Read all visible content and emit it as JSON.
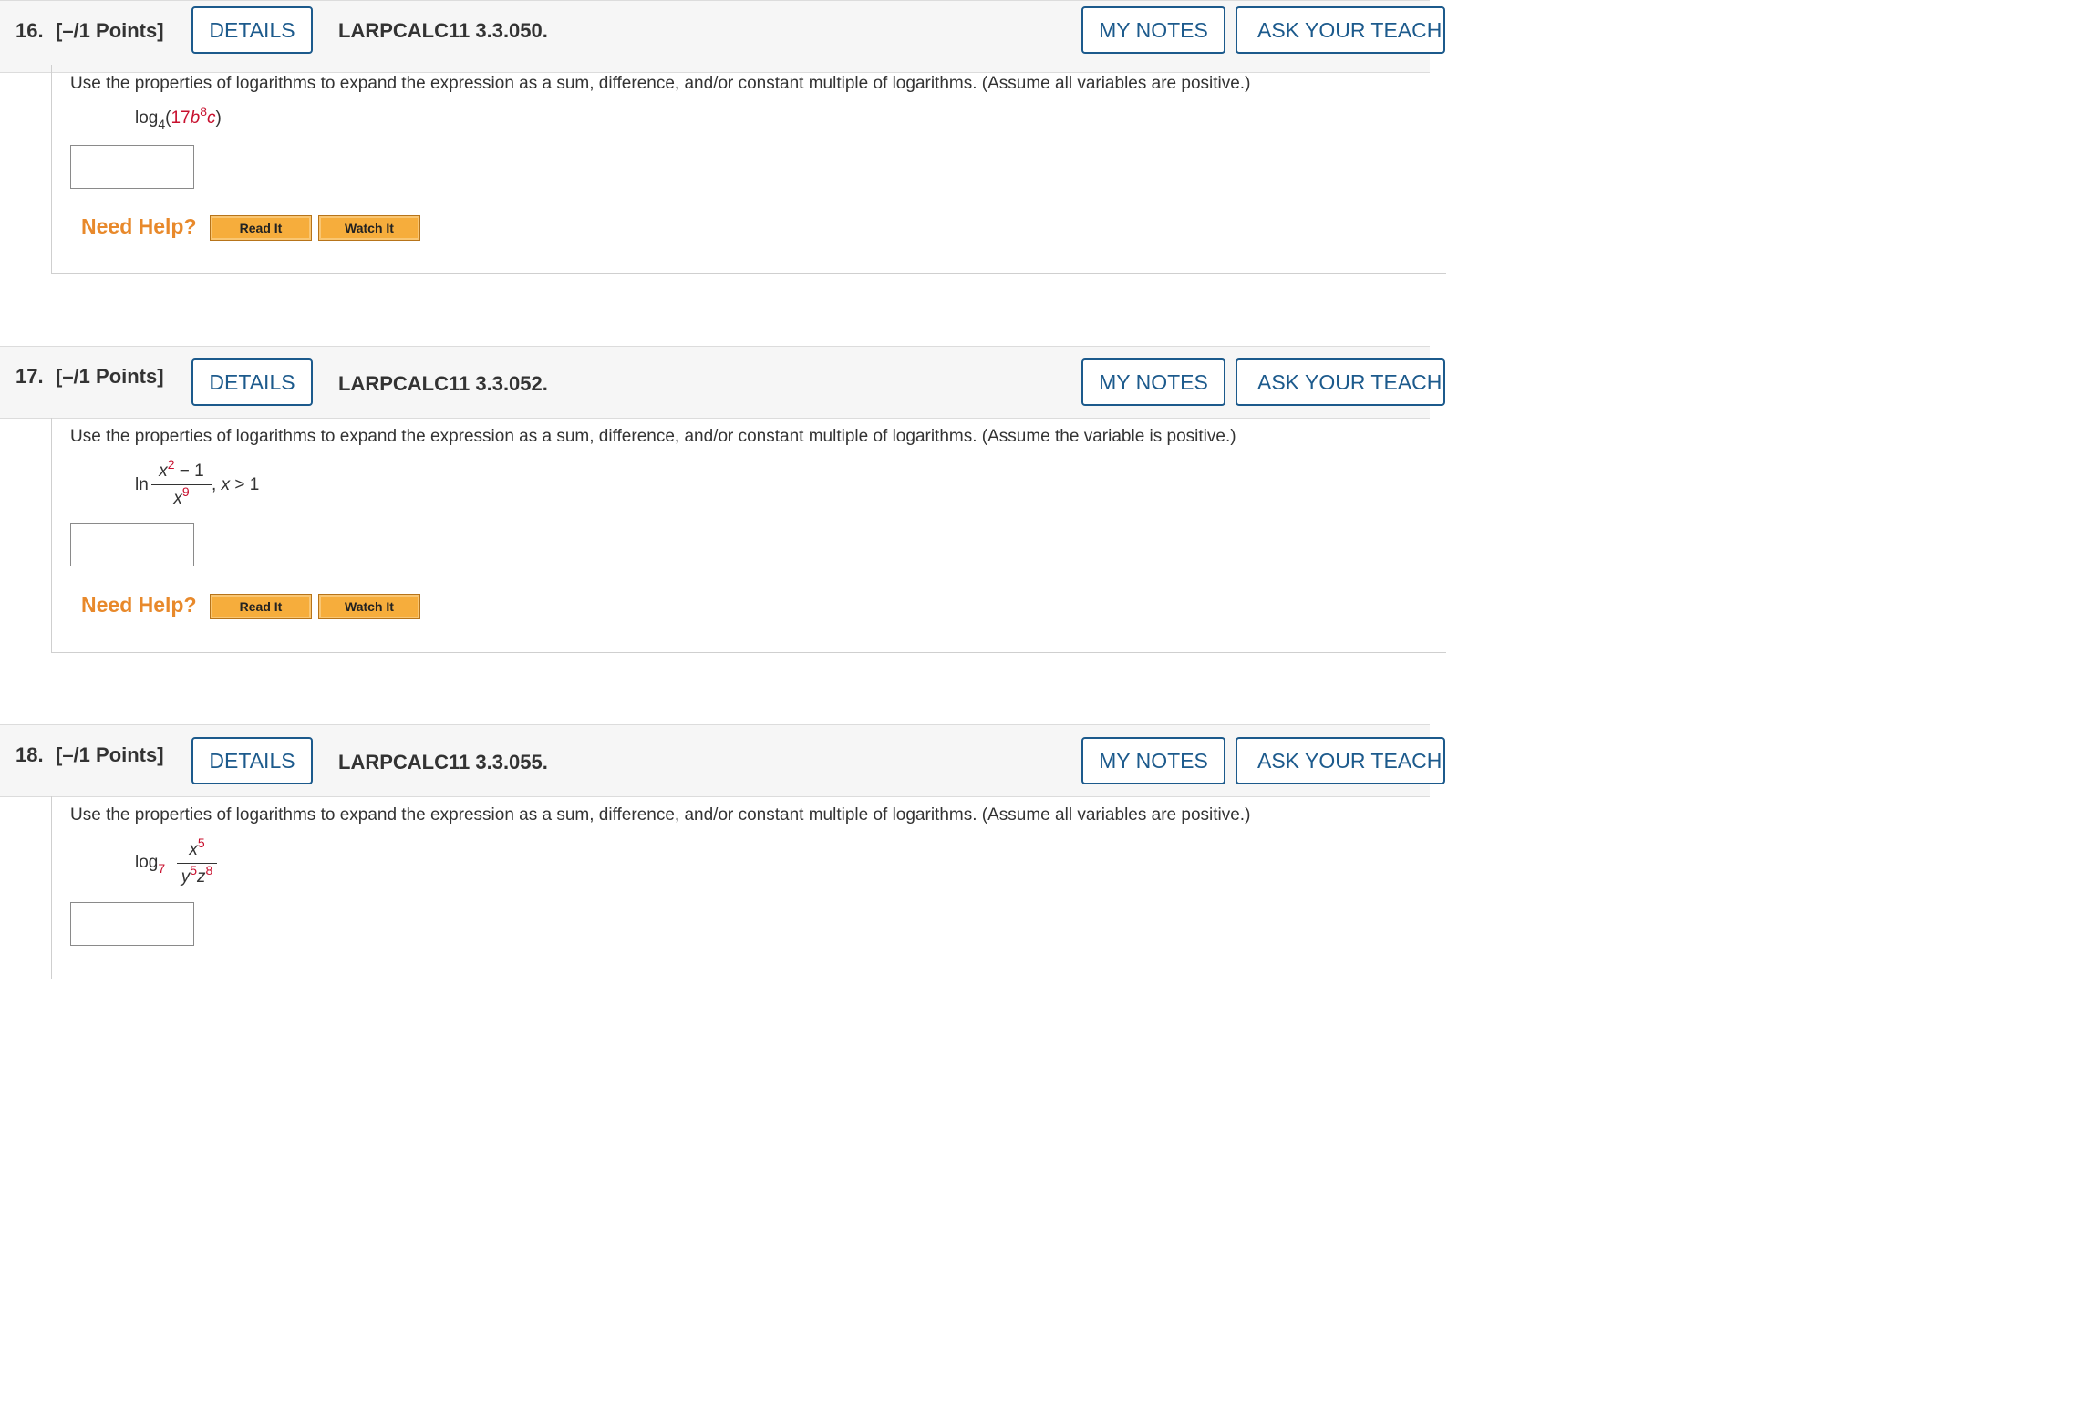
{
  "questions": [
    {
      "number": "16.",
      "points": "[–/1 Points]",
      "details_label": "DETAILS",
      "code": "LARPCALC11 3.3.050.",
      "my_notes_label": "MY NOTES",
      "ask_label": "ASK YOUR TEACHER",
      "prompt": "Use the properties of logarithms to expand the expression as a sum, difference, and/or constant multiple of logarithms. (Assume all variables are positive.)",
      "expression": {
        "fn": "log",
        "base": "4",
        "open": "(",
        "coef": "17",
        "var1": "b",
        "exp1": "8",
        "var2": "c",
        "close": ")"
      },
      "need_help": "Need Help?",
      "read_it": "Read It",
      "watch_it": "Watch It"
    },
    {
      "number": "17.",
      "points": "[–/1 Points]",
      "details_label": "DETAILS",
      "code": "LARPCALC11 3.3.052.",
      "my_notes_label": "MY NOTES",
      "ask_label": "ASK YOUR TEACHER",
      "prompt": "Use the properties of logarithms to expand the expression as a sum, difference, and/or constant multiple of logarithms. (Assume the variable is positive.)",
      "expression": {
        "fn": "ln",
        "num_var": "x",
        "num_exp": "2",
        "num_rest": " − 1",
        "den_var": "x",
        "den_exp": "9",
        "condition_sep": ", ",
        "cond_var": "x",
        "cond_rest": " > 1"
      },
      "need_help": "Need Help?",
      "read_it": "Read It",
      "watch_it": "Watch It"
    },
    {
      "number": "18.",
      "points": "[–/1 Points]",
      "details_label": "DETAILS",
      "code": "LARPCALC11 3.3.055.",
      "my_notes_label": "MY NOTES",
      "ask_label": "ASK YOUR TEACHER",
      "prompt": "Use the properties of logarithms to expand the expression as a sum, difference, and/or constant multiple of logarithms. (Assume all variables are positive.)",
      "expression": {
        "fn": "log",
        "base": "7",
        "num_var": "x",
        "num_exp": "5",
        "den_var1": "y",
        "den_exp1": "5",
        "den_var2": "z",
        "den_exp2": "8"
      }
    }
  ],
  "colors": {
    "link_blue": "#1c5a8c",
    "need_help_orange": "#e8892b",
    "exponent_red": "#c8102e",
    "help_button": "#f6ad3c"
  }
}
